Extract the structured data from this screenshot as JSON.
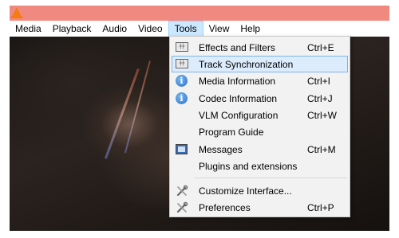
{
  "menubar": {
    "items": [
      "Media",
      "Playback",
      "Audio",
      "Video",
      "Tools",
      "View",
      "Help"
    ],
    "active": "Tools"
  },
  "tools_menu": {
    "items": [
      {
        "label": "Effects and Filters",
        "shortcut": "Ctrl+E",
        "icon": "equalizer-icon"
      },
      {
        "label": "Track Synchronization",
        "shortcut": "",
        "icon": "equalizer-icon",
        "highlighted": true
      },
      {
        "label": "Media Information",
        "shortcut": "Ctrl+I",
        "icon": "info-icon"
      },
      {
        "label": "Codec Information",
        "shortcut": "Ctrl+J",
        "icon": "info-icon"
      },
      {
        "label": "VLM Configuration",
        "shortcut": "Ctrl+W",
        "icon": ""
      },
      {
        "label": "Program Guide",
        "shortcut": "",
        "icon": ""
      },
      {
        "label": "Messages",
        "shortcut": "Ctrl+M",
        "icon": "messages-icon"
      },
      {
        "label": "Plugins and extensions",
        "shortcut": "",
        "icon": ""
      },
      {
        "label": "Customize Interface...",
        "shortcut": "",
        "icon": "tools-icon"
      },
      {
        "label": "Preferences",
        "shortcut": "Ctrl+P",
        "icon": "tools-icon"
      }
    ]
  },
  "colors": {
    "titlebar": "#f08a80",
    "menu_highlight": "#dcecfc",
    "menu_highlight_border": "#7eb4ea",
    "menubar_active": "#cce8ff"
  }
}
